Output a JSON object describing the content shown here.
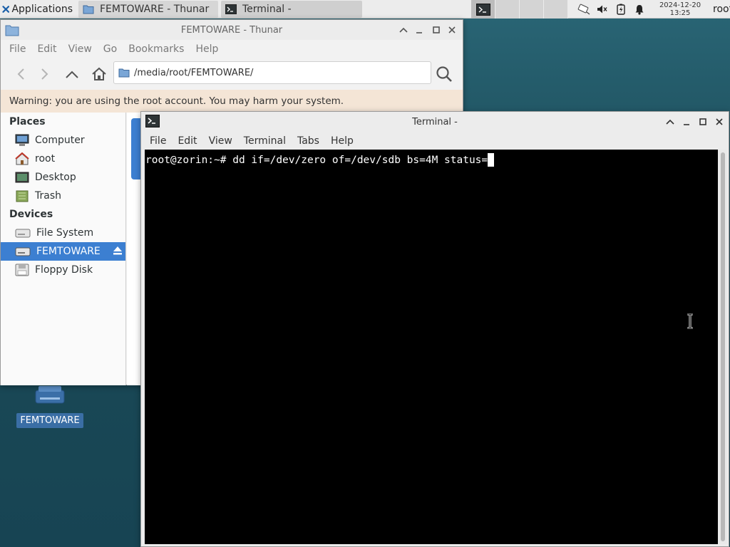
{
  "panel": {
    "applications_label": "Applications",
    "tasks": [
      {
        "label": "FEMTOWARE - Thunar"
      },
      {
        "label": "Terminal -"
      }
    ],
    "clock": {
      "date": "2024-12-20",
      "time": "13:25"
    },
    "user": "root"
  },
  "desktop": {
    "icon_label": "FEMTOWARE"
  },
  "thunar": {
    "title": "FEMTOWARE - Thunar",
    "menu": [
      "File",
      "Edit",
      "View",
      "Go",
      "Bookmarks",
      "Help"
    ],
    "location": "/media/root/FEMTOWARE/",
    "warning": "Warning: you are using the root account. You may harm your system.",
    "places_header": "Places",
    "places": [
      {
        "label": "Computer",
        "icon": "computer-icon"
      },
      {
        "label": "root",
        "icon": "home-icon"
      },
      {
        "label": "Desktop",
        "icon": "desktop-icon"
      },
      {
        "label": "Trash",
        "icon": "trash-icon"
      }
    ],
    "devices_header": "Devices",
    "devices": [
      {
        "label": "File System",
        "icon": "drive-icon"
      },
      {
        "label": "FEMTOWARE",
        "icon": "usb-drive-icon",
        "selected": true
      },
      {
        "label": "Floppy Disk",
        "icon": "floppy-icon"
      }
    ]
  },
  "terminal": {
    "title": "Terminal -",
    "menu": [
      "File",
      "Edit",
      "View",
      "Terminal",
      "Tabs",
      "Help"
    ],
    "prompt": "root@zorin:~# ",
    "command": "dd if=/dev/zero of=/dev/sdb bs=4M status="
  },
  "colors": {
    "selection": "#3c7fd1",
    "warning_bg": "#f4e5d6",
    "terminal_bg": "#000000",
    "desktop_bg": "#1f4e5c"
  }
}
